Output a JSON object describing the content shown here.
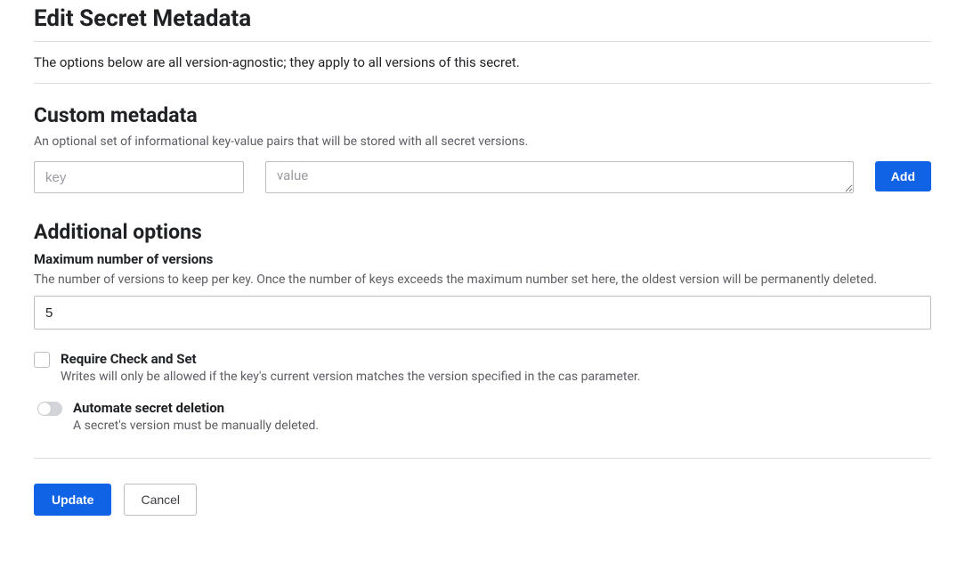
{
  "page": {
    "title": "Edit Secret Metadata",
    "description": "The options below are all version-agnostic; they apply to all versions of this secret."
  },
  "custom_metadata": {
    "title": "Custom metadata",
    "subtext": "An optional set of informational key-value pairs that will be stored with all secret versions.",
    "key_placeholder": "key",
    "value_placeholder": "value",
    "add_label": "Add"
  },
  "additional": {
    "title": "Additional options",
    "max_versions": {
      "label": "Maximum number of versions",
      "help": "The number of versions to keep per key. Once the number of keys exceeds the maximum number set here, the oldest version will be permanently deleted.",
      "value": "5"
    },
    "require_cas": {
      "label": "Require Check and Set",
      "help": "Writes will only be allowed if the key's current version matches the version specified in the cas parameter."
    },
    "automate_delete": {
      "label": "Automate secret deletion",
      "help": "A secret's version must be manually deleted."
    }
  },
  "footer": {
    "update_label": "Update",
    "cancel_label": "Cancel"
  }
}
